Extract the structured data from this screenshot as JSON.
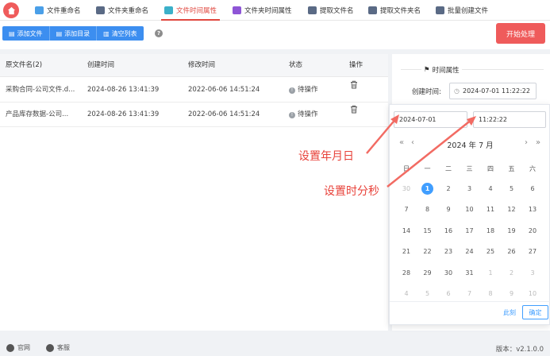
{
  "nav": {
    "tabs": [
      {
        "label": "文件重命名",
        "icon": "file-rename-icon",
        "color": "#4a9fe8"
      },
      {
        "label": "文件夹重命名",
        "icon": "folder-rename-icon",
        "color": "#5a6a85"
      },
      {
        "label": "文件时间属性",
        "icon": "file-time-icon",
        "color": "#3bb0c9"
      },
      {
        "label": "文件夹时间属性",
        "icon": "folder-time-icon",
        "color": "#8e55d6"
      },
      {
        "label": "提取文件名",
        "icon": "extract-filename-icon",
        "color": "#5a6a85"
      },
      {
        "label": "提取文件夹名",
        "icon": "extract-foldername-icon",
        "color": "#5a6a85"
      },
      {
        "label": "批量创建文件",
        "icon": "batch-create-icon",
        "color": "#5a6a85"
      }
    ],
    "active_tab": 2,
    "accent": "#e0473f"
  },
  "toolbar": {
    "add_file": "添加文件",
    "add_folder": "添加目录",
    "clear_list": "清空列表",
    "help": "?",
    "start": "开始处理"
  },
  "table": {
    "headers": [
      "原文件名(2)",
      "创建时间",
      "修改时间",
      "状态",
      "操作"
    ],
    "rows": [
      {
        "name": "采购合同-公司文件.d...",
        "created": "2024-08-26 13:41:39",
        "modified": "2022-06-06 14:51:24",
        "status": "待操作"
      },
      {
        "name": "产品库存数据-公司...",
        "created": "2024-08-26 13:41:39",
        "modified": "2022-06-06 14:51:24",
        "status": "待操作"
      }
    ]
  },
  "right_panel": {
    "section_title": "时间属性",
    "created_label": "创建时间:",
    "created_value": "2024-07-01 11:22:22"
  },
  "picker": {
    "date_input": "2024-07-01",
    "time_input": "11:22:22",
    "title": "2024 年  7 月",
    "weekdays": [
      "日",
      "一",
      "二",
      "三",
      "四",
      "五",
      "六"
    ],
    "days": [
      [
        "30",
        "1",
        "2",
        "3",
        "4",
        "5",
        "6"
      ],
      [
        "7",
        "8",
        "9",
        "10",
        "11",
        "12",
        "13"
      ],
      [
        "14",
        "15",
        "16",
        "17",
        "18",
        "19",
        "20"
      ],
      [
        "21",
        "22",
        "23",
        "24",
        "25",
        "26",
        "27"
      ],
      [
        "28",
        "29",
        "30",
        "31",
        "1",
        "2",
        "3"
      ],
      [
        "4",
        "5",
        "6",
        "7",
        "8",
        "9",
        "10"
      ]
    ],
    "selected_day": "1",
    "clear": "此刻",
    "ok": "确定",
    "nav_prev_year": "«",
    "nav_prev_month": "‹",
    "nav_next_month": "›",
    "nav_next_year": "»"
  },
  "annotations": {
    "set_date": "设置年月日",
    "set_time": "设置时分秒",
    "color": "#e8423a"
  },
  "statusbar": {
    "website": "官网",
    "support": "客服",
    "version": "版本：v2.1.0.0"
  }
}
